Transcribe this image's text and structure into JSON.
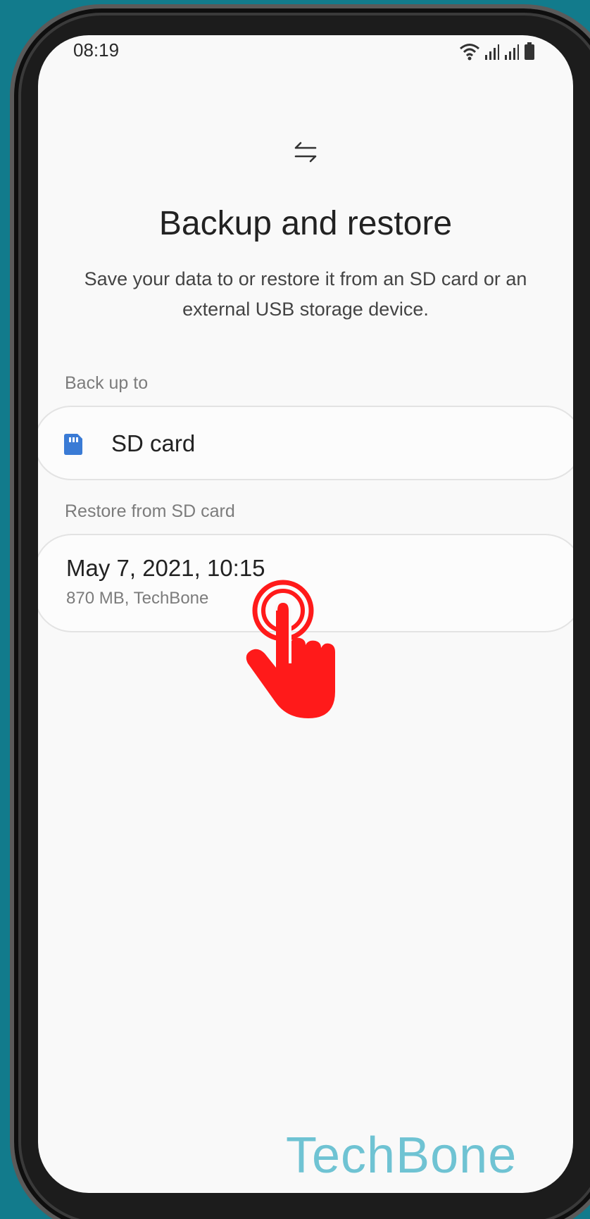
{
  "status_bar": {
    "time": "08:19",
    "icons": [
      "wifi-icon",
      "signal-icon",
      "signal-icon",
      "battery-icon"
    ]
  },
  "header": {
    "icon": "transfer-arrows-icon",
    "title": "Backup and restore",
    "description": "Save your data to or restore it from an SD card or an external USB storage device."
  },
  "backup_section": {
    "label": "Back up to",
    "item": {
      "icon": "sd-card-icon",
      "label": "SD card",
      "icon_color": "#3a7bd5"
    }
  },
  "restore_section": {
    "label": "Restore from SD card",
    "item": {
      "date": "May 7, 2021, 10:15",
      "details": "870 MB, TechBone"
    }
  },
  "overlay": {
    "icon": "tap-hand-icon",
    "color": "#ff1a1a"
  },
  "watermark": "TechBone"
}
